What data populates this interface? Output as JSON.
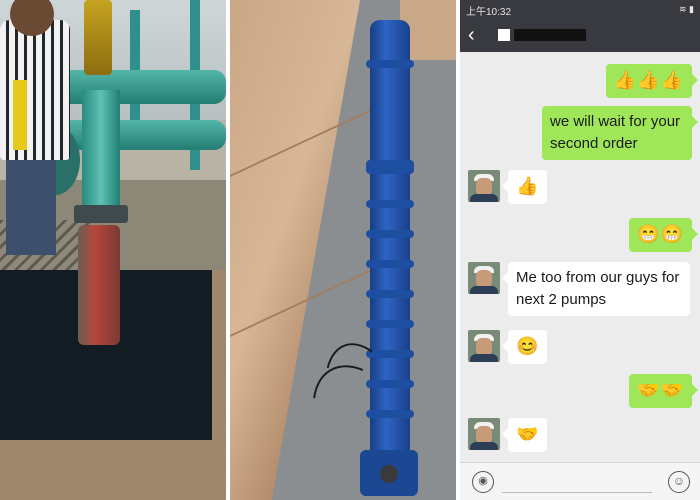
{
  "photos": {
    "left": {
      "icon": "pump-installation-photo"
    },
    "middle": {
      "icon": "submersible-pump-photo"
    }
  },
  "status_bar": {
    "time": "上午10:32",
    "icons": "≋ ▮"
  },
  "nav": {
    "back_icon": "‹",
    "contact_name_redacted": true
  },
  "messages": [
    {
      "side": "out",
      "text": "👍👍👍"
    },
    {
      "side": "out",
      "text": "we will wait for your second order"
    },
    {
      "side": "in",
      "text": "👍"
    },
    {
      "side": "out",
      "text": "😁😁"
    },
    {
      "side": "in",
      "text": "Me too from our guys for next 2 pumps"
    },
    {
      "side": "in",
      "text": "😊"
    },
    {
      "side": "out",
      "text": "🤝🤝"
    },
    {
      "side": "in",
      "text": "🤝"
    }
  ],
  "input_bar": {
    "voice_icon": "◉",
    "emoji_icon": "☺"
  },
  "colors": {
    "outgoing_bubble": "#9fe658",
    "incoming_bubble": "#ffffff",
    "chat_background": "#ececec",
    "header_background": "#393a3f"
  }
}
